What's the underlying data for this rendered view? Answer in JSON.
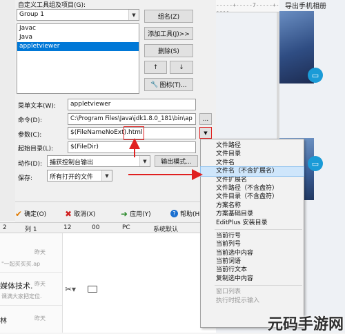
{
  "dialog": {
    "group_label": "自定义工具组及项目(G):",
    "group_combo": "Group 1",
    "tools": [
      "Javac",
      "Java",
      "appletviewer"
    ],
    "selected_tool_index": 2,
    "buttons": {
      "group_name": "组名(Z)",
      "add_tool": "添加工具(J)>>",
      "delete": "删除(S)",
      "up": "↑",
      "down": "↓",
      "icon": "图标(T)..."
    },
    "fields": {
      "menu_text_label": "菜单文本(W):",
      "menu_text": "appletviewer",
      "command_label": "命令(D):",
      "command": "C:\\Program Files\\Java\\jdk1.8.0_181\\bin\\ap",
      "command_browse": "...",
      "args_label": "参数(C):",
      "args": "$(FileNameNoExt).html",
      "init_dir_label": "起始目录(L):",
      "init_dir": "$(FileDir)",
      "action_label": "动作(D):",
      "action": "捕获控制台输出",
      "output_mode": "输出模式...",
      "save_label": "保存:",
      "save": "所有打开的文件"
    },
    "footer": {
      "ok": "确定(O)",
      "cancel": "取消(X)",
      "apply": "应用(Y)",
      "help": "帮助(H)"
    }
  },
  "context_menu": {
    "items": [
      {
        "label": "文件路径",
        "state": "normal"
      },
      {
        "label": "文件目录",
        "state": "normal"
      },
      {
        "label": "文件名",
        "state": "normal"
      },
      {
        "label": "文件名（不含扩展名）",
        "state": "selected"
      },
      {
        "label": "文件扩展名",
        "state": "normal"
      },
      {
        "label": "文件路径（不含盘符）",
        "state": "normal"
      },
      {
        "label": "文件目录（不含盘符）",
        "state": "normal"
      },
      {
        "label": "方案名称",
        "state": "normal"
      },
      {
        "label": "方案基础目录",
        "state": "normal"
      },
      {
        "label": "EditPlus 安装目录",
        "state": "normal"
      },
      {
        "label": "当前行号",
        "state": "normal"
      },
      {
        "label": "当前列号",
        "state": "normal"
      },
      {
        "label": "当前选中内容",
        "state": "normal"
      },
      {
        "label": "当前词语",
        "state": "normal"
      },
      {
        "label": "当前行文本",
        "state": "normal"
      },
      {
        "label": "复制选中内容",
        "state": "normal"
      },
      {
        "label": "窗口列表",
        "state": "disabled"
      },
      {
        "label": "执行时提示输入",
        "state": "disabled"
      }
    ]
  },
  "status_bar": {
    "cells": [
      "2",
      "列 1",
      "12",
      "00",
      "PC",
      "系统默认"
    ]
  },
  "background": {
    "top_right_text": "导出手机相册",
    "chat_items": [
      {
        "time": "昨天",
        "preview": "\"一起买买买.ap"
      },
      {
        "time": "昨天",
        "title": "媒体技术.",
        "preview": "课满大家把定位."
      },
      {
        "time": "昨天",
        "title": "林"
      }
    ]
  },
  "watermark": "元码手游网",
  "colors": {
    "selection_blue": "#0078d7",
    "annotation_red": "#e02020",
    "menu_highlight": "#cfe6fb",
    "teal_icon": "#1a9bd7"
  }
}
